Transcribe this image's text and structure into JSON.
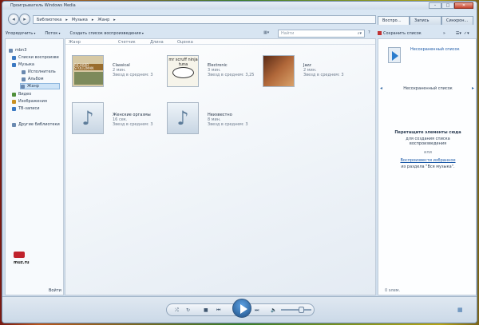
{
  "window": {
    "title": "Проигрыватель Windows Media"
  },
  "window_controls": {
    "minimize": "–",
    "maximize": "□",
    "close": "✕"
  },
  "nav": {
    "back": "◂",
    "forward": "▸",
    "breadcrumb": [
      "Библиотека",
      "Музыка",
      "Жанр"
    ]
  },
  "tabs": [
    "Воспро...",
    "Запись",
    "Синхрон..."
  ],
  "toolbar": {
    "organize": "Упорядочить",
    "stream": "Поток",
    "create_playlist": "Создать список воспроизведения",
    "search_placeholder": "Найти",
    "save_list": "Сохранить список"
  },
  "sidebar": {
    "items": [
      {
        "label": "mbn3",
        "color": "#6a89b0"
      },
      {
        "label": "Списки воспроизве",
        "color": "#3a78c2"
      },
      {
        "label": "Музыка",
        "color": "#3a78c2"
      },
      {
        "label": "Исполнитель",
        "color": "#6a89b0"
      },
      {
        "label": "Альбом",
        "color": "#6a89b0"
      },
      {
        "label": "Жанр",
        "color": "#6a89b0"
      },
      {
        "label": "Видео",
        "color": "#4f8f3a"
      },
      {
        "label": "Изображения",
        "color": "#c99022"
      },
      {
        "label": "ТВ-записи",
        "color": "#3a78c2"
      },
      {
        "label": "Другие библиотеки",
        "color": "#6a89b0"
      }
    ],
    "logo_text": "muz.ru",
    "sign_in": "Войти"
  },
  "columns": [
    "Жанр",
    "Счетчик",
    "Длина",
    "Оценка"
  ],
  "albums": [
    {
      "name": "Classical",
      "count": "2 мин.",
      "rating": "Звезд в среднем: 3",
      "art": "RICHARD STOLTZMAN"
    },
    {
      "name": "Electronic",
      "count": "3 мин.",
      "rating": "Звезд в среднем: 3,25",
      "art": "mr scruff ninja tuna"
    },
    {
      "name": "Jazz",
      "count": "2 мин.",
      "rating": "Звезд в среднем: 3",
      "art": ""
    },
    {
      "name": "Женские оргазмы",
      "count": "16 сек.",
      "rating": "Звезд в среднем: 3",
      "art": ""
    },
    {
      "name": "Неизвестно",
      "count": "8 мин.",
      "rating": "Звезд в среднем: 3",
      "art": ""
    }
  ],
  "right_panel": {
    "unsaved_title": "Несохраненный список",
    "unsaved_label": "Несохраненный список",
    "drag_title": "Перетащите элементы сюда",
    "drag_sub": "для создания списка воспроизведения",
    "or": "или",
    "play_favorites": "Воспроизвести избранное",
    "from_section": "из раздела \"Вся музыка\".",
    "count": "0 элем."
  },
  "player": {
    "shuffle": "⤮",
    "repeat": "↻",
    "stop": "■",
    "prev": "⏮",
    "next": "⏭",
    "mute": "🔈",
    "switch": "▦"
  }
}
